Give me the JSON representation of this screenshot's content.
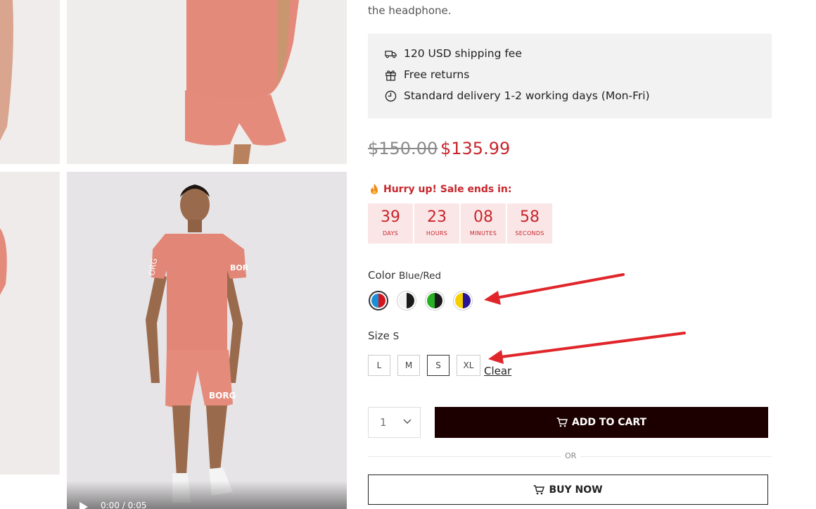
{
  "description_tail": "the headphone.",
  "shipping": [
    {
      "icon": "truck-icon",
      "text": "120 USD shipping fee"
    },
    {
      "icon": "gift-icon",
      "text": "Free returns"
    },
    {
      "icon": "clock-icon",
      "text": "Standard delivery 1-2 working days (Mon-Fri)"
    }
  ],
  "price": {
    "old": "$150.00",
    "new": "$135.99"
  },
  "sale": {
    "headline": "Hurry up! Sale ends in:",
    "countdown": [
      {
        "value": "39",
        "label": "DAYS"
      },
      {
        "value": "23",
        "label": "HOURS"
      },
      {
        "value": "08",
        "label": "MINUTES"
      },
      {
        "value": "58",
        "label": "SECONDS"
      }
    ]
  },
  "color": {
    "label": "Color",
    "selected": "Blue/Red",
    "options": [
      {
        "name": "Blue/Red",
        "left": "#1a8fd8",
        "right": "#d4151d"
      },
      {
        "name": "White/Black",
        "left": "#f2f2f2",
        "right": "#1a1a1a"
      },
      {
        "name": "Green/Black",
        "left": "#27b024",
        "right": "#1a1a1a"
      },
      {
        "name": "Yellow/Navy",
        "left": "#f4d000",
        "right": "#2a1596"
      }
    ]
  },
  "size": {
    "label": "Size",
    "selected": "S",
    "options": [
      "L",
      "M",
      "S",
      "XL"
    ],
    "clear_label": "Clear"
  },
  "quantity": "1",
  "add_to_cart": "ADD TO CART",
  "or": "OR",
  "buy_now": "BUY NOW",
  "video": {
    "time": "0:00 / 0:05"
  },
  "colors": {
    "sale_red": "#c8262c",
    "cart_bg": "#1c0000",
    "annotation_arrow": "#e0262b"
  }
}
